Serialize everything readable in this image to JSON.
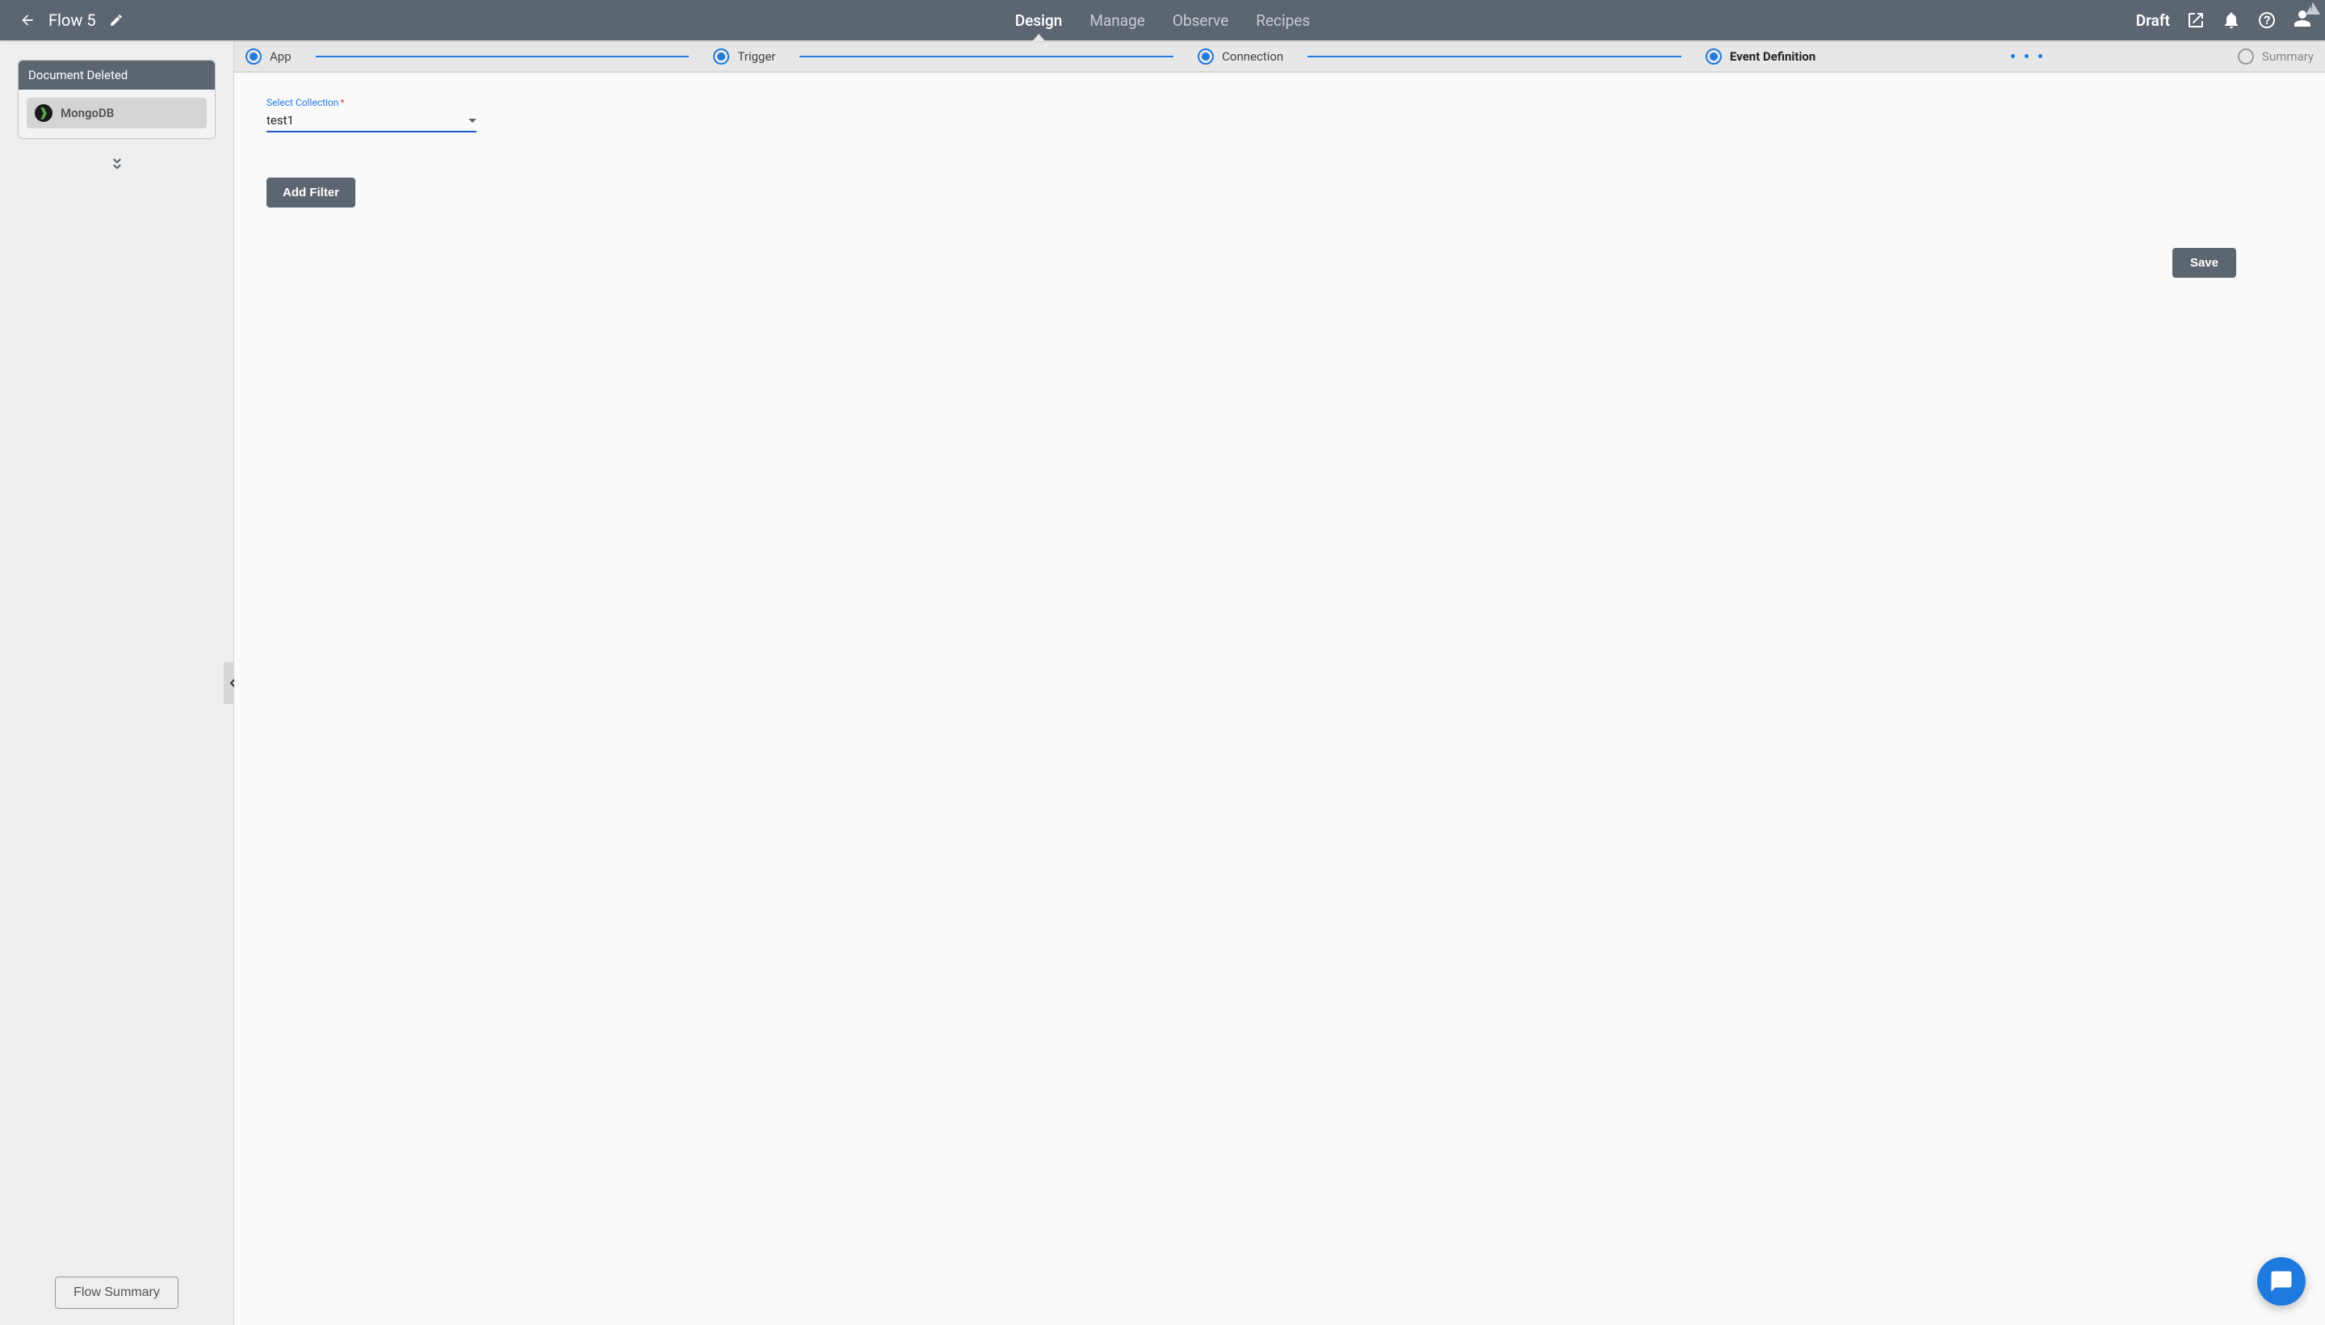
{
  "header": {
    "flow_title": "Flow 5",
    "status": "Draft",
    "tabs": {
      "design": "Design",
      "manage": "Manage",
      "observe": "Observe",
      "recipes": "Recipes"
    }
  },
  "sidebar": {
    "card_title": "Document Deleted",
    "app_name": "MongoDB",
    "flow_summary_btn": "Flow Summary"
  },
  "stepper": {
    "app": "App",
    "trigger": "Trigger",
    "connection": "Connection",
    "event_def": "Event Definition",
    "summary": "Summary"
  },
  "form": {
    "select_label": "Select Collection",
    "select_value": "test1",
    "add_filter_btn": "Add Filter",
    "save_btn": "Save"
  },
  "icons": {
    "back": "back-arrow-icon",
    "pencil": "edit-pencil-icon",
    "external": "external-link-icon",
    "bell": "notifications-icon",
    "help": "help-icon",
    "user": "user-icon",
    "chat": "chat-bubble-icon",
    "chevrons": "chevrons-down-icon",
    "chevron_left": "chevron-left-icon"
  }
}
